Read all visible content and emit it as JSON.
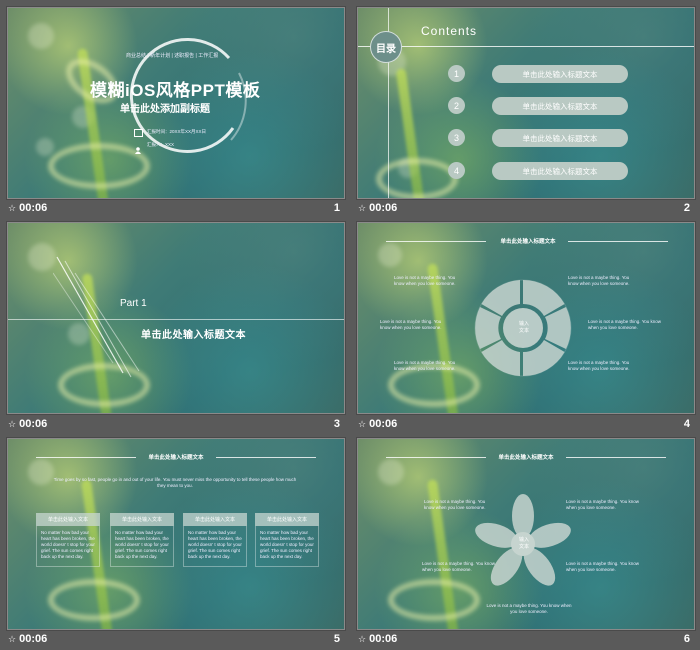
{
  "slides": [
    {
      "number": "1",
      "time": "00:06",
      "tags": "商业总结 | 新年计划 | 述职报告 | 工作汇报",
      "title": "模糊iOS风格PPT模板",
      "subtitle": "单击此处添加副标题",
      "date": "汇报时间：20XX年XX月XX日",
      "reporter": "汇报人：XXX"
    },
    {
      "number": "2",
      "time": "00:06",
      "badge": "目录",
      "heading": "Contents",
      "items": [
        {
          "n": "1",
          "label": "单击此处输入标题文本"
        },
        {
          "n": "2",
          "label": "单击此处输入标题文本"
        },
        {
          "n": "3",
          "label": "单击此处输入标题文本"
        },
        {
          "n": "4",
          "label": "单击此处输入标题文本"
        }
      ]
    },
    {
      "number": "3",
      "time": "00:06",
      "part": "Part 1",
      "title": "单击此处输入标题文本"
    },
    {
      "number": "4",
      "time": "00:06",
      "title": "单击此处输入标题文本",
      "center": "输入\n文本",
      "text_left_top": "Love is not a maybe thing. You know when you love someone.",
      "text_right_top": "Love is not a maybe thing. You know when you love someone.",
      "text_left_mid": "Love is not a maybe thing. You know when you love someone.",
      "text_right_mid": "Love is not a maybe thing. You know when you love someone.",
      "text_left_bot": "Love is not a maybe thing. You know when you love someone.",
      "text_right_bot": "Love is not a maybe thing. You know when you love someone."
    },
    {
      "number": "5",
      "time": "00:06",
      "title": "单击此处输入标题文本",
      "intro": "Time goes by so fast, people go in and out of your life. You must never miss the opportunity to tell these people how much they mean to you.",
      "cards": [
        {
          "head": "单击此处输入文本",
          "body": "No matter how bad your heart has been broken, the world doesn' t stop for your grief. The sun comes right back up the next day."
        },
        {
          "head": "单击此处输入文本",
          "body": "No matter how bad your heart has been broken, the world doesn' t stop for your grief. The sun comes right back up the next day."
        },
        {
          "head": "单击此处输入文本",
          "body": "No matter how bad your heart has been broken, the world doesn' t stop for your grief. The sun comes right back up the next day."
        },
        {
          "head": "单击此处输入文本",
          "body": "No matter how bad your heart has been broken, the world doesn' t stop for your grief. The sun comes right back up the next day."
        }
      ]
    },
    {
      "number": "6",
      "time": "00:06",
      "title": "单击此处输入标题文本",
      "center": "输入\n文本",
      "text_left_top": "Love is not a maybe thing. You know when you love someone.",
      "text_right_top": "Love is not a maybe thing. You know when you love someone.",
      "text_left_bot": "Love is not a maybe thing. You know when you love someone.",
      "text_right_bot": "Love is not a maybe thing. You know when you love someone.",
      "text_bottom": "Love is not a maybe thing. You know when you love someone."
    }
  ],
  "colors": {
    "background": "#5a5a5a",
    "pill": "#b9c9c3",
    "pill_text": "#ffffff",
    "circle": "#c6d4cf"
  }
}
